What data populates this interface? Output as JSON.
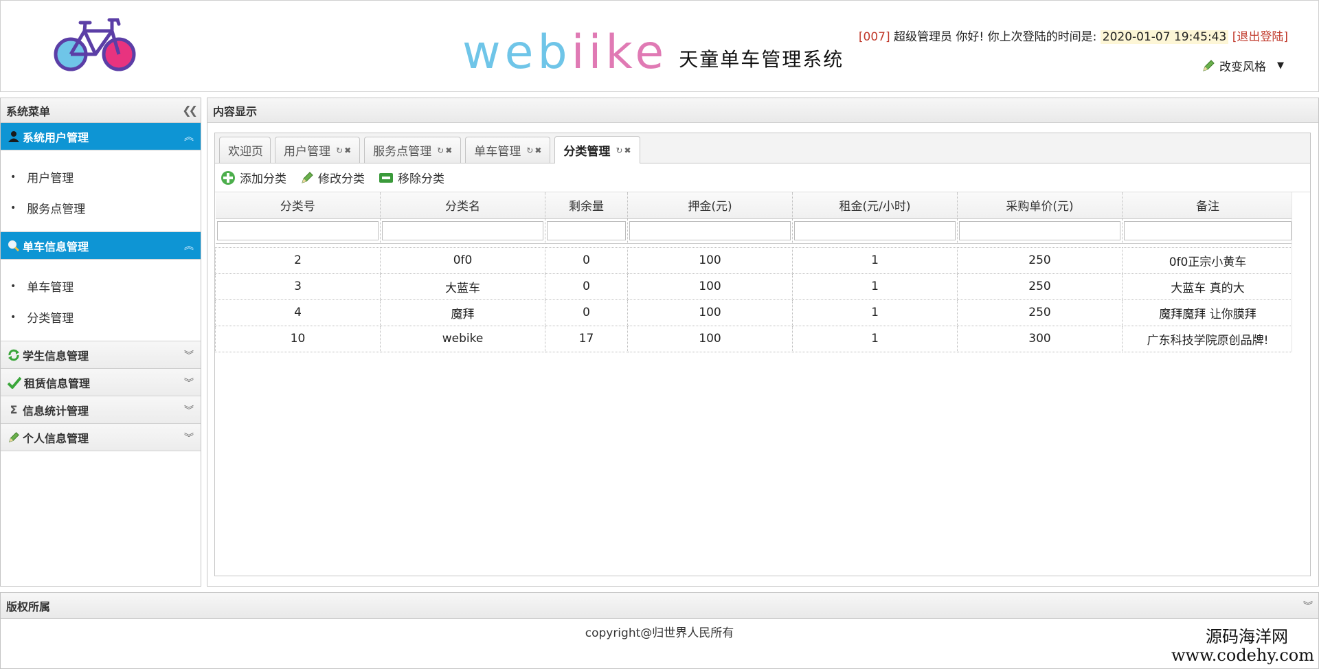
{
  "header": {
    "brand_word_a": "web",
    "brand_word_b": "ike",
    "brand_i": "i",
    "brand_sub": "天童单车管理系统",
    "user_id": "[007]",
    "user_role": "超级管理员",
    "greeting": "你好! 你上次登陆的时间是:",
    "last_login": "2020-01-07 19:45:43",
    "logout": "[退出登陆]",
    "theme_label": "改变风格"
  },
  "sidebar": {
    "title": "系统菜单",
    "groups": [
      {
        "label": "系统用户管理",
        "icon": "user-icon",
        "open": true,
        "items": [
          "用户管理",
          "服务点管理"
        ]
      },
      {
        "label": "单车信息管理",
        "icon": "search-icon",
        "open": true,
        "items": [
          "单车管理",
          "分类管理"
        ]
      },
      {
        "label": "学生信息管理",
        "icon": "refresh-icon",
        "open": false
      },
      {
        "label": "租赁信息管理",
        "icon": "check-icon",
        "open": false
      },
      {
        "label": "信息统计管理",
        "icon": "sigma-icon",
        "open": false
      },
      {
        "label": "个人信息管理",
        "icon": "pencil-icon",
        "open": false
      }
    ]
  },
  "main": {
    "title": "内容显示",
    "tabs": [
      {
        "label": "欢迎页",
        "closable": false,
        "active": false
      },
      {
        "label": "用户管理",
        "closable": true,
        "active": false
      },
      {
        "label": "服务点管理",
        "closable": true,
        "active": false
      },
      {
        "label": "单车管理",
        "closable": true,
        "active": false
      },
      {
        "label": "分类管理",
        "closable": true,
        "active": true
      }
    ],
    "toolbar": {
      "add": "添加分类",
      "edit": "修改分类",
      "remove": "移除分类"
    },
    "table": {
      "columns": [
        "分类号",
        "分类名",
        "剩余量",
        "押金(元)",
        "租金(元/小时)",
        "采购单价(元)",
        "备注"
      ],
      "rows": [
        [
          "2",
          "0f0",
          "0",
          "100",
          "1",
          "250",
          "0f0正宗小黄车"
        ],
        [
          "3",
          "大蓝车",
          "0",
          "100",
          "1",
          "250",
          "大蓝车 真的大"
        ],
        [
          "4",
          "魔拜",
          "0",
          "100",
          "1",
          "250",
          "魔拜魔拜 让你膜拜"
        ],
        [
          "10",
          "webike",
          "17",
          "100",
          "1",
          "300",
          "广东科技学院原创品牌!"
        ]
      ]
    }
  },
  "footer": {
    "title": "版权所属",
    "copyright": "copyright@归世界人民所有",
    "watermark_line1": "源码海洋网",
    "watermark_line2": "www.codehy.com"
  },
  "colors": {
    "menu_active": "#0e95d4",
    "brand_blue": "#6fc5e8",
    "brand_pink": "#e07ab4",
    "accent_red": "#c0392b"
  }
}
